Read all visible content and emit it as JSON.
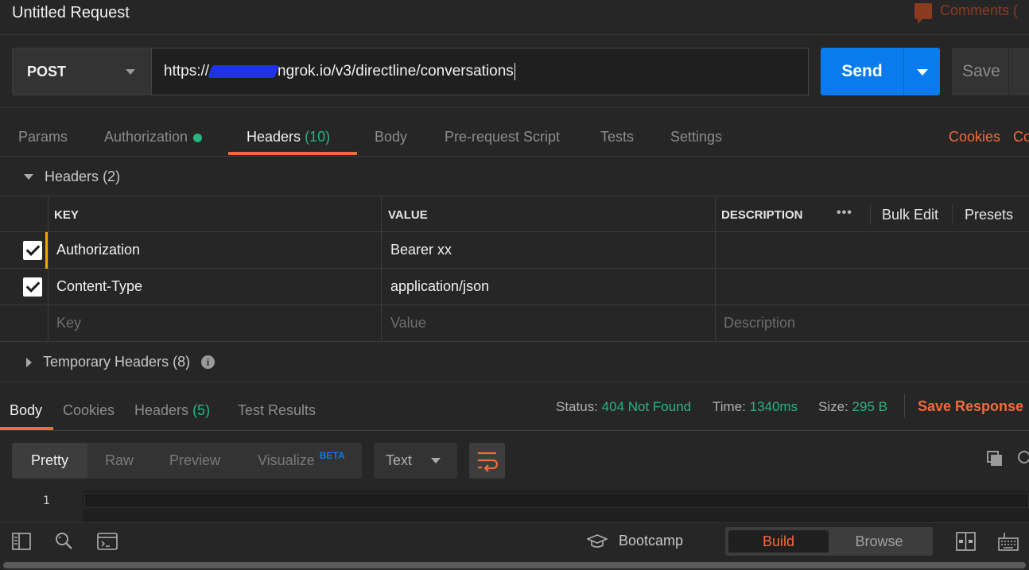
{
  "title": "Untitled Request",
  "comments_label": "Comments (",
  "request": {
    "method": "POST",
    "url_prefix": "https://",
    "url_suffix": "ngrok.io/v3/directline/conversations",
    "send_label": "Send",
    "save_label": "Save"
  },
  "request_tabs": {
    "params": "Params",
    "authorization": "Authorization",
    "headers": "Headers",
    "headers_count": "(10)",
    "body": "Body",
    "prerequest": "Pre-request Script",
    "tests": "Tests",
    "settings": "Settings",
    "cookies": "Cookies",
    "code": "Co"
  },
  "headers_section": {
    "title": "Headers",
    "count": "(2)",
    "columns": {
      "key": "KEY",
      "value": "VALUE",
      "description": "DESCRIPTION"
    },
    "more": "•••",
    "bulk_edit": "Bulk Edit",
    "presets": "Presets",
    "rows": [
      {
        "key": "Authorization",
        "value": "Bearer xx"
      },
      {
        "key": "Content-Type",
        "value": "application/json"
      }
    ],
    "placeholders": {
      "key": "Key",
      "value": "Value",
      "description": "Description"
    },
    "temporary_title": "Temporary Headers",
    "temporary_count": "(8)"
  },
  "response": {
    "tabs": {
      "body": "Body",
      "cookies": "Cookies",
      "headers": "Headers",
      "headers_count": "(5)",
      "test_results": "Test Results"
    },
    "status_label": "Status:",
    "status_value": "404 Not Found",
    "time_label": "Time:",
    "time_value": "1340ms",
    "size_label": "Size:",
    "size_value": "295 B",
    "save_response": "Save Response",
    "format": {
      "pretty": "Pretty",
      "raw": "Raw",
      "preview": "Preview",
      "visualize": "Visualize",
      "beta": "BETA"
    },
    "content_type": "Text",
    "line_number": "1"
  },
  "status_bar": {
    "bootcamp": "Bootcamp",
    "build": "Build",
    "browse": "Browse"
  },
  "colors": {
    "accent_orange": "#f26b3a",
    "send_blue": "#097bed",
    "status_green": "#26b47f"
  }
}
